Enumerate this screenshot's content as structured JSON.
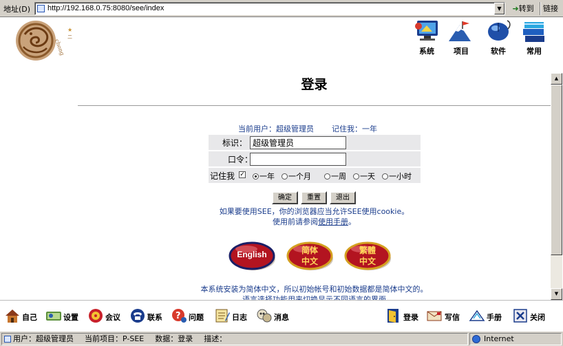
{
  "addressbar": {
    "label": "地址(D)",
    "url": "http://192.168.0.75:8080/see/index",
    "go_label": "转到",
    "links_label": "链接"
  },
  "top_nav": [
    {
      "label": "系统",
      "icon": "monitor-icon"
    },
    {
      "label": "项目",
      "icon": "mountain-flag-icon"
    },
    {
      "label": "软件",
      "icon": "mouse-icon"
    },
    {
      "label": "常用",
      "icon": "book-stack-icon"
    }
  ],
  "login": {
    "title": "登录",
    "status": {
      "current_user_label": "当前用户：超级管理员",
      "remember_label": "记住我：一年"
    },
    "id_label": "标识",
    "id_value": "超级管理员",
    "password_label": "口令",
    "password_value": "",
    "remember_me_label": "记住我",
    "remember_checked": true,
    "remember_options": [
      "一年",
      "一个月",
      "一周",
      "一天",
      "一小时"
    ],
    "remember_selected": "一年",
    "buttons": {
      "ok": "确定",
      "reset": "重置",
      "exit": "退出"
    },
    "cookie_note": "如果要使用SEE，你的浏览器应当允许SEE使用cookie。",
    "manual_note_prefix": "使用前请参阅",
    "manual_link": "使用手册",
    "manual_note_suffix": "。",
    "install_note": "本系统安装为简体中文，所以初始帐号和初始数据都是简体中文的。",
    "install_note2": "语言选择功能用来切换显示不同语言的界面"
  },
  "languages": [
    {
      "label": "English",
      "color": "#b31420"
    },
    {
      "label_line1": "简体",
      "label_line2": "中文",
      "color": "#b31420"
    },
    {
      "label_line1": "繁體",
      "label_line2": "中文",
      "color": "#b31420"
    }
  ],
  "bottom_toolbar": {
    "left": [
      {
        "label": "自己",
        "icon": "house-icon"
      },
      {
        "label": "设置",
        "icon": "settings-icon"
      },
      {
        "label": "会议",
        "icon": "meeting-icon"
      },
      {
        "label": "联系",
        "icon": "phone-icon"
      },
      {
        "label": "问题",
        "icon": "question-icon"
      },
      {
        "label": "日志",
        "icon": "log-icon"
      },
      {
        "label": "消息",
        "icon": "message-icon"
      }
    ],
    "right": [
      {
        "label": "登录",
        "icon": "login-door-icon"
      },
      {
        "label": "写信",
        "icon": "letter-icon"
      },
      {
        "label": "手册",
        "icon": "manual-icon"
      },
      {
        "label": "关闭",
        "icon": "close-icon"
      }
    ]
  },
  "statusbar": {
    "user": "用户：超级管理员",
    "project": "当前项目：P-SEE",
    "data": "数据：登录",
    "desc": "描述：",
    "zone": "Internet"
  }
}
